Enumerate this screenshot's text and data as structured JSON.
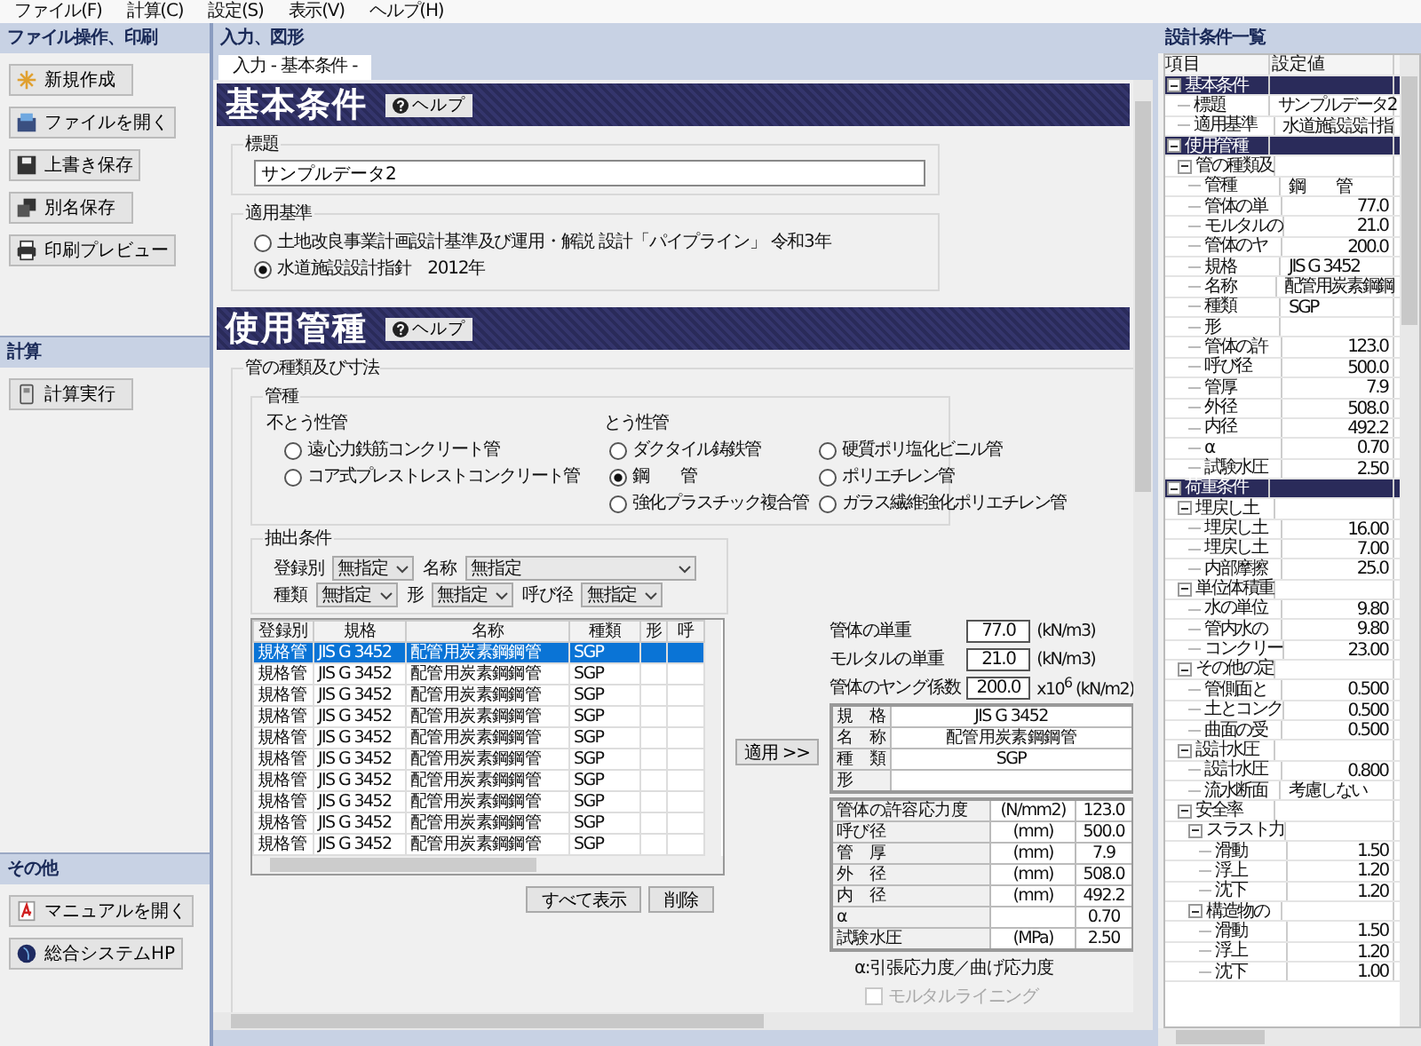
{
  "menu": [
    "ファイル(F)",
    "計算(C)",
    "設定(S)",
    "表示(V)",
    "ヘルプ(H)"
  ],
  "left_panel": {
    "sections": [
      {
        "title": "ファイル操作、印刷",
        "buttons": [
          {
            "label": "新規作成",
            "kind": "new"
          },
          {
            "label": "ファイルを開く",
            "kind": "open"
          },
          {
            "label": "上書き保存",
            "kind": "save"
          },
          {
            "label": "別名保存",
            "kind": "saveas"
          },
          {
            "label": "印刷プレビュー",
            "kind": "print"
          }
        ]
      },
      {
        "title": "計算",
        "buttons": [
          {
            "label": "計算実行",
            "kind": "calc"
          }
        ]
      },
      {
        "title": "その他",
        "buttons": [
          {
            "label": "マニュアルを開く",
            "kind": "manual"
          },
          {
            "label": "総合システムHP",
            "kind": "web"
          }
        ]
      }
    ]
  },
  "center": {
    "title": "入力、図形",
    "tabs": [
      {
        "label": "入力 - 基本条件 -",
        "selected": true
      }
    ],
    "basic": {
      "heading": "基本条件",
      "help": "ヘルプ",
      "title_group": {
        "label": "標題",
        "value": "サンプルデータ2"
      },
      "standard_group": {
        "label": "適用基準",
        "options": [
          {
            "label": "土地改良事業計画設計基準及び運用・解説 設計「パイプライン」 令和3年",
            "selected": false
          },
          {
            "label": "水道施設設計指針　2012年",
            "selected": true
          }
        ]
      }
    },
    "pipe": {
      "heading": "使用管種",
      "help": "ヘルプ",
      "group_label": "管の種類及び寸法",
      "types": {
        "label": "管種",
        "columns": [
          {
            "label": "不とう性管",
            "options": [
              {
                "label": "遠心力鉄筋コンクリート管",
                "selected": false
              },
              {
                "label": "コア式プレストレストコンクリート管",
                "selected": false
              }
            ]
          },
          {
            "label": "とう性管",
            "options": [
              {
                "label": "ダクタイル鋳鉄管",
                "selected": false
              },
              {
                "label": "鋼　　管",
                "selected": true
              },
              {
                "label": "強化プラスチック複合管",
                "selected": false
              },
              {
                "label": "硬質ポリ塩化ビニル管",
                "selected": false
              },
              {
                "label": "ポリエチレン管",
                "selected": false
              },
              {
                "label": "ガラス繊維強化ポリエチレン管",
                "selected": false
              }
            ]
          }
        ]
      },
      "filter": {
        "label": "抽出条件",
        "rows": [
          [
            {
              "label": "登録別",
              "value": "無指定",
              "kind": "short"
            },
            {
              "label": "名称",
              "value": "無指定",
              "kind": "wide"
            }
          ],
          [
            {
              "label": "種類",
              "value": "無指定",
              "kind": "short"
            },
            {
              "label": "形",
              "value": "無指定",
              "kind": "short"
            },
            {
              "label": "呼び径",
              "value": "無指定",
              "kind": "short"
            }
          ]
        ]
      },
      "table": {
        "columns": [
          "登録別",
          "規格",
          "名称",
          "種類",
          "形",
          "呼"
        ],
        "rows": [
          {
            "cells": [
              "規格管",
              "JIS G 3452",
              "配管用炭素鋼鋼管",
              "SGP"
            ],
            "selected": true
          },
          {
            "cells": [
              "規格管",
              "JIS G 3452",
              "配管用炭素鋼鋼管",
              "SGP"
            ],
            "selected": false
          },
          {
            "cells": [
              "規格管",
              "JIS G 3452",
              "配管用炭素鋼鋼管",
              "SGP"
            ],
            "selected": false
          },
          {
            "cells": [
              "規格管",
              "JIS G 3452",
              "配管用炭素鋼鋼管",
              "SGP"
            ],
            "selected": false
          },
          {
            "cells": [
              "規格管",
              "JIS G 3452",
              "配管用炭素鋼鋼管",
              "SGP"
            ],
            "selected": false
          },
          {
            "cells": [
              "規格管",
              "JIS G 3452",
              "配管用炭素鋼鋼管",
              "SGP"
            ],
            "selected": false
          },
          {
            "cells": [
              "規格管",
              "JIS G 3452",
              "配管用炭素鋼鋼管",
              "SGP"
            ],
            "selected": false
          },
          {
            "cells": [
              "規格管",
              "JIS G 3452",
              "配管用炭素鋼鋼管",
              "SGP"
            ],
            "selected": false
          },
          {
            "cells": [
              "規格管",
              "JIS G 3452",
              "配管用炭素鋼鋼管",
              "SGP"
            ],
            "selected": false
          },
          {
            "cells": [
              "規格管",
              "JIS G 3452",
              "配管用炭素鋼鋼管",
              "SGP"
            ],
            "selected": false
          }
        ]
      },
      "table_buttons": [
        "すべて表示",
        "削除"
      ],
      "apply": "適用 >>",
      "props": [
        {
          "label": "管体の単重",
          "value": "77.0",
          "unit": "(kN/m3)"
        },
        {
          "label": "モルタルの単重",
          "value": "21.0",
          "unit": "(kN/m3)"
        },
        {
          "label": "管体のヤング係数",
          "value": "200.0",
          "unit": "x10$^{6}$ (kN/m2)"
        }
      ],
      "spec": [
        {
          "label": "規　格",
          "value": "JIS G 3452"
        },
        {
          "label": "名　称",
          "value": "配管用炭素鋼鋼管"
        },
        {
          "label": "種　類",
          "value": "SGP"
        },
        {
          "label": "形"
        }
      ],
      "dims": [
        {
          "label": "管体の許容応力度",
          "unit": "(N/mm2)",
          "value": "123.0"
        },
        {
          "label": "呼び径",
          "unit": "(mm)",
          "value": "500.0"
        },
        {
          "label": "管　厚",
          "unit": "(mm)",
          "value": "7.9"
        },
        {
          "label": "外　径",
          "unit": "(mm)",
          "value": "508.0"
        },
        {
          "label": "内　径",
          "unit": "(mm)",
          "value": "492.2"
        },
        {
          "label": "α",
          "value": "0.70"
        },
        {
          "label": "試験水圧",
          "unit": "(MPa)",
          "value": "2.50"
        }
      ],
      "note": "α:引張応力度／曲げ応力度",
      "lining": {
        "label": "モルタルライニング",
        "checked": false,
        "disabled": true
      }
    }
  },
  "right_panel": {
    "title": "設計条件一覧",
    "columns": [
      "項目",
      "設定値"
    ],
    "tree": [
      {
        "name": "基本条件",
        "kind": "category",
        "expanded": true,
        "children": [
          {
            "name": "標題",
            "kind": "text",
            "value": "サンプルデータ2"
          },
          {
            "name": "適用基準",
            "kind": "text",
            "value": "水道施設設計指"
          }
        ]
      },
      {
        "name": "使用管種",
        "kind": "category",
        "expanded": true,
        "children": [
          {
            "name": "管の種類及",
            "kind": "group",
            "expanded": true,
            "children": [
              {
                "name": "管種",
                "kind": "text",
                "value": "鋼　　管"
              },
              {
                "name": "管体の単",
                "kind": "number",
                "value": "77.0"
              },
              {
                "name": "モルタルの",
                "kind": "number",
                "value": "21.0"
              },
              {
                "name": "管体のヤ",
                "kind": "number",
                "value": "200.0"
              },
              {
                "name": "規格",
                "kind": "text",
                "value": "JIS G 3452"
              },
              {
                "name": "名称",
                "kind": "text",
                "value": "配管用炭素鋼鋼"
              },
              {
                "name": "種類",
                "kind": "text",
                "value": "SGP"
              },
              {
                "name": "形",
                "kind": "text"
              },
              {
                "name": "管体の許",
                "kind": "number",
                "value": "123.0"
              },
              {
                "name": "呼び径",
                "kind": "number",
                "value": "500.0"
              },
              {
                "name": "管厚",
                "kind": "number",
                "value": "7.9"
              },
              {
                "name": "外径",
                "kind": "number",
                "value": "508.0"
              },
              {
                "name": "内径",
                "kind": "number",
                "value": "492.2"
              },
              {
                "name": "α",
                "kind": "number",
                "value": "0.70"
              },
              {
                "name": "試験水圧",
                "kind": "number",
                "value": "2.50"
              }
            ]
          }
        ]
      },
      {
        "name": "荷重条件",
        "kind": "category",
        "expanded": true,
        "children": [
          {
            "name": "埋戻し土",
            "kind": "group",
            "expanded": true,
            "children": [
              {
                "name": "埋戻し土",
                "kind": "number",
                "value": "16.00"
              },
              {
                "name": "埋戻し土",
                "kind": "number",
                "value": "7.00"
              },
              {
                "name": "内部摩擦",
                "kind": "number",
                "value": "25.0"
              }
            ]
          },
          {
            "name": "単位体積重",
            "kind": "group",
            "expanded": true,
            "children": [
              {
                "name": "水の単位",
                "kind": "number",
                "value": "9.80"
              },
              {
                "name": "管内水の",
                "kind": "number",
                "value": "9.80"
              },
              {
                "name": "コンクリー",
                "kind": "number",
                "value": "23.00"
              }
            ]
          },
          {
            "name": "その他の定",
            "kind": "group",
            "expanded": true,
            "children": [
              {
                "name": "管側面と",
                "kind": "number",
                "value": "0.500"
              },
              {
                "name": "土とコンク",
                "kind": "number",
                "value": "0.500"
              },
              {
                "name": "曲面の受",
                "kind": "number",
                "value": "0.500"
              }
            ]
          },
          {
            "name": "設計水圧",
            "kind": "group",
            "expanded": true,
            "children": [
              {
                "name": "設計水圧",
                "kind": "number",
                "value": "0.800"
              },
              {
                "name": "流水断面",
                "kind": "text",
                "value": "考慮しない"
              }
            ]
          },
          {
            "name": "安全率",
            "kind": "group",
            "expanded": true,
            "children": [
              {
                "name": "スラスト力",
                "kind": "group",
                "expanded": true,
                "children": [
                  {
                    "name": "滑動",
                    "kind": "number",
                    "value": "1.50"
                  },
                  {
                    "name": "浮上",
                    "kind": "number",
                    "value": "1.20"
                  },
                  {
                    "name": "沈下",
                    "kind": "number",
                    "value": "1.20"
                  }
                ]
              },
              {
                "name": "構造物の",
                "kind": "group",
                "expanded": true,
                "children": [
                  {
                    "name": "滑動",
                    "kind": "number",
                    "value": "1.50"
                  },
                  {
                    "name": "浮上",
                    "kind": "number",
                    "value": "1.20"
                  },
                  {
                    "name": "沈下",
                    "kind": "number",
                    "value": "1.00"
                  }
                ]
              }
            ]
          }
        ]
      }
    ]
  }
}
